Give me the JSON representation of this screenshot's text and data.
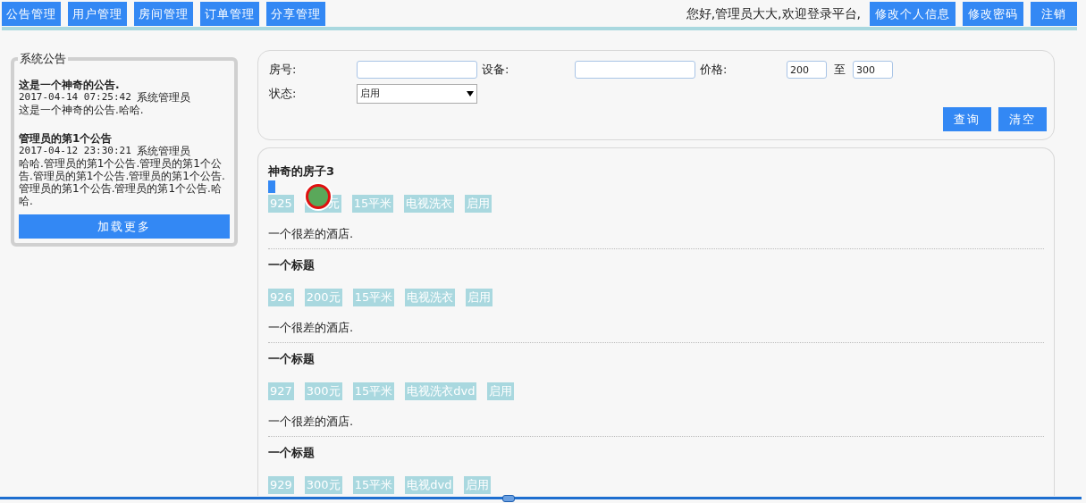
{
  "nav": {
    "items": [
      "公告管理",
      "用户管理",
      "房间管理",
      "订单管理",
      "分享管理"
    ],
    "greeting": "您好,管理员大大,欢迎登录平台,",
    "actions": [
      "修改个人信息",
      "修改密码",
      "注销"
    ]
  },
  "notices": {
    "title": "系统公告",
    "items": [
      {
        "title": "这是一个神奇的公告.",
        "time": "2017-04-14 07:25:42",
        "author": "系统管理员",
        "body": "这是一个神奇的公告.哈哈."
      },
      {
        "title": "管理员的第1个公告",
        "time": "2017-04-12 23:30:21",
        "author": "系统管理员",
        "body": "哈哈.管理员的第1个公告.管理员的第1个公告.管理员的第1个公告.管理员的第1个公告.管理员的第1个公告.管理员的第1个公告.哈哈."
      }
    ],
    "more_button": "加载更多"
  },
  "filter": {
    "room_label": "房号:",
    "device_label": "设备:",
    "price_label": "价格:",
    "price_min": "200",
    "price_to": "至",
    "price_max": "300",
    "status_label": "状态:",
    "status_value": "启用",
    "buttons": [
      "查询",
      "清空"
    ]
  },
  "rooms": [
    {
      "title": "神奇的房子3",
      "marked": true,
      "tags": [
        "925",
        "元",
        "15平米",
        "电视洗衣",
        "启用"
      ],
      "description": "一个很差的酒店."
    },
    {
      "title": "一个标题",
      "marked": false,
      "tags": [
        "926",
        "200元",
        "15平米",
        "电视洗衣",
        "启用"
      ],
      "description": "一个很差的酒店."
    },
    {
      "title": "一个标题",
      "marked": false,
      "tags": [
        "927",
        "300元",
        "15平米",
        "电视洗衣dvd",
        "启用"
      ],
      "description": "一个很差的酒店."
    },
    {
      "title": "一个标题",
      "marked": false,
      "tags": [
        "929",
        "300元",
        "15平米",
        "电视dvd",
        "启用"
      ]
    }
  ]
}
